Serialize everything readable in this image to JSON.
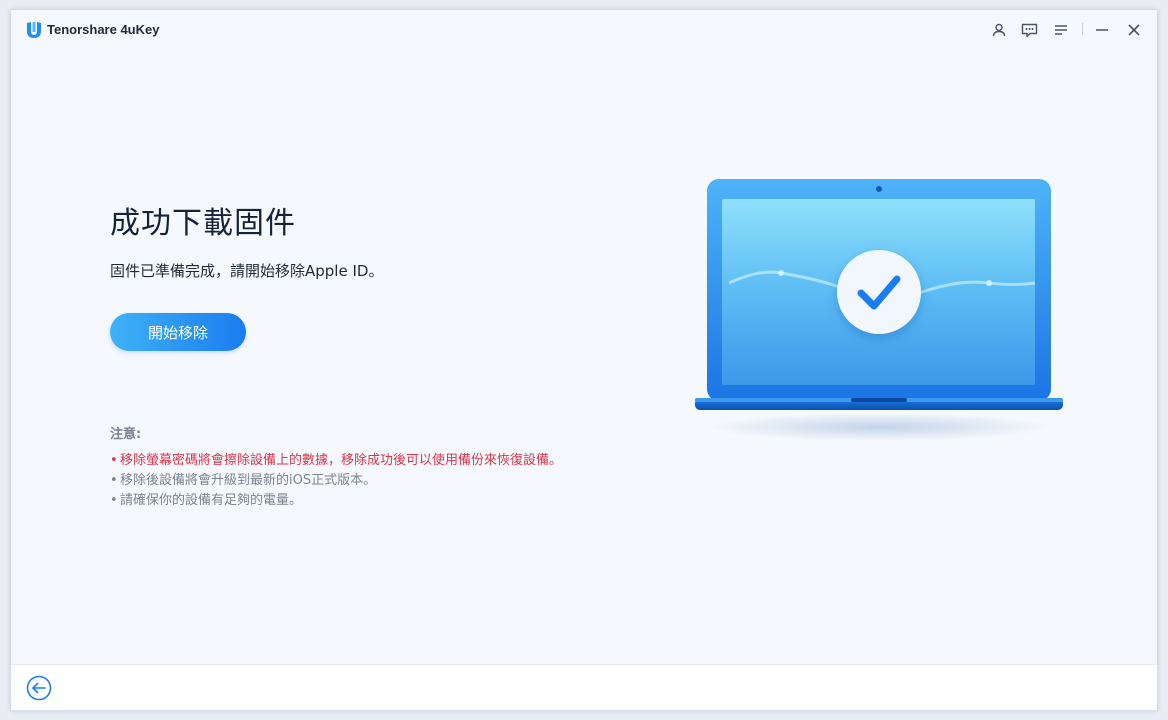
{
  "app": {
    "title": "Tenorshare 4uKey"
  },
  "titlebar": {
    "icons": [
      "user-icon",
      "feedback-icon",
      "menu-icon",
      "minimize-icon",
      "close-icon"
    ]
  },
  "main": {
    "title": "成功下載固件",
    "subtitle": "固件已準備完成，請開始移除Apple ID。",
    "start_button_label": "開始移除",
    "note_title": "注意:",
    "notes": [
      "移除螢幕密碼將會擦除設備上的數據，移除成功後可以使用備份來恢復設備。",
      "移除後設備將會升級到最新的iOS正式版本。",
      "請確保你的設備有足夠的電量。"
    ],
    "bullet": "•"
  },
  "illustration": {
    "icon": "laptop-success-icon"
  },
  "bottombar": {
    "icons": [
      "back-arrow-icon"
    ]
  },
  "colors": {
    "accent": "#1a7df0",
    "warning": "#d9364a",
    "title": "#14233a"
  }
}
